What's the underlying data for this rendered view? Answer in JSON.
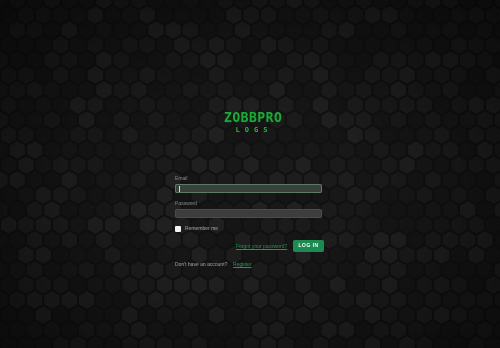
{
  "logo": {
    "title": "ZOBBPRO",
    "subtitle": "LOGS"
  },
  "form": {
    "email_label": "Email",
    "email_value": "",
    "password_label": "Password",
    "password_value": "",
    "remember_label": "Remember me",
    "remember_checked": false,
    "forgot_label": "Forgot your password?",
    "login_label": "LOG IN",
    "no_account_label": "Don't have an account?",
    "register_label": "Register"
  },
  "colors": {
    "accent": "#1d8a52",
    "link": "#1f9a4a",
    "logo_green": "#22a83a",
    "background": "#111111"
  }
}
